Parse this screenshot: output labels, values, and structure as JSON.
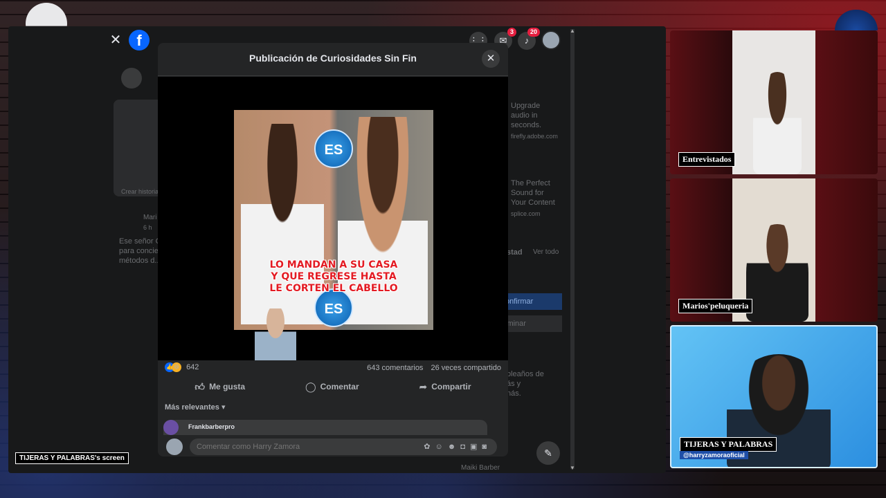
{
  "screen_share": {
    "tag": "TIJERAS Y PALABRAS's screen"
  },
  "facebook": {
    "logo": "f",
    "topbar": {
      "messenger_badge": "3",
      "notifications_badge": "20"
    },
    "background_feed": {
      "story_label": "Crear historia",
      "post_author": "Mari",
      "post_time": "6 h",
      "post_text": "Ese señor C\npara concie\nmétodos d...",
      "ad1": "Upgrade\naudio in\nseconds.",
      "ad1_domain": "firefly.adobe.com",
      "ad2": "The Perfect\nSound for\nYour Content",
      "ad2_domain": "splice.com",
      "birthday_header": "stad",
      "see_all": "Ver todo",
      "confirm_label": "onfirmar",
      "delete_label": "iminar",
      "birthday_text": "pleaños de\nás y\nnás.",
      "contact_name": "Maiki Barber"
    },
    "modal": {
      "title": "Publicación de Curiosidades Sin Fin",
      "media_caption_lines": [
        "LO MANDAN A SU CASA",
        "Y QUE REGRESE HASTA",
        "LE CORTEN EL CABELLO"
      ],
      "logo_text": "ES",
      "reaction_count": "642",
      "comments_count": "643 comentarios",
      "shares_count": "26 veces compartido",
      "actions": {
        "like": "Me gusta",
        "comment": "Comentar",
        "share": "Compartir"
      },
      "sort_label": "Más relevantes",
      "comment_preview_author": "Frankbarberpro",
      "composer_placeholder": "Comentar como Harry Zamora"
    }
  },
  "participants": [
    {
      "label": "Entrevistados"
    },
    {
      "label": "Marios'peluqueria"
    },
    {
      "label": "TIJERAS Y PALABRAS",
      "handle": "@harryzamoraoficial"
    }
  ],
  "colors": {
    "fb_blue": "#0866ff",
    "fb_dark": "#242526",
    "badge_red": "#e41e3f",
    "caption_red": "#e31b23"
  }
}
